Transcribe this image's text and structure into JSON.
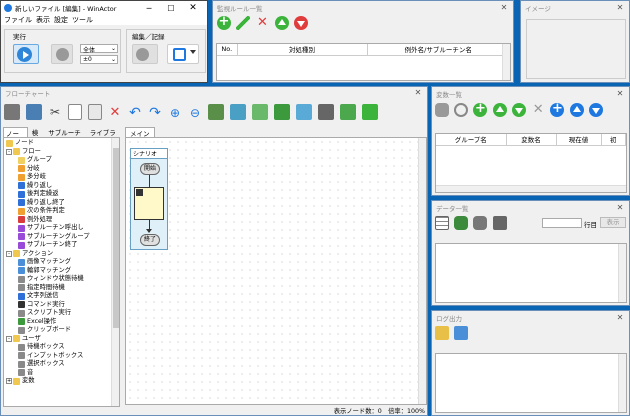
{
  "main_window": {
    "title": "新しいファイル [編集] - WinActor",
    "menu": [
      "ファイル",
      "表示",
      "設定",
      "ツール"
    ],
    "run_group_label": "実行",
    "edit_group_label": "編集／記録",
    "scope_select": "全体",
    "speed_select": "±0"
  },
  "rule_list": {
    "title": "監視ルール一覧",
    "columns": [
      "No.",
      "対処種別",
      "例外名/サブルーチン名"
    ]
  },
  "image_panel": {
    "title": "イメージ"
  },
  "flowchart": {
    "title": "フローチャート",
    "left_tabs": [
      "ノード",
      "検索",
      "サブルーチン",
      "ライブラリ"
    ],
    "canvas_tab": "メイン",
    "scenario_label": "シナリオ",
    "start_label": "開始",
    "end_label": "終了",
    "status": "表示ノード数：0　倍率：100%",
    "tree": [
      {
        "level": 0,
        "label": "ノード",
        "type": "folder",
        "toggle": ""
      },
      {
        "level": 0,
        "label": "フロー",
        "type": "folder",
        "toggle": "-"
      },
      {
        "level": 1,
        "label": "グループ",
        "type": "yellow"
      },
      {
        "level": 1,
        "label": "分岐",
        "type": "orange"
      },
      {
        "level": 1,
        "label": "多分岐",
        "type": "orange"
      },
      {
        "level": 1,
        "label": "繰り返し",
        "type": "blue"
      },
      {
        "level": 1,
        "label": "後判定繰返",
        "type": "blue"
      },
      {
        "level": 1,
        "label": "繰り返し終了",
        "type": "blue"
      },
      {
        "level": 1,
        "label": "次の条件判定",
        "type": "orange"
      },
      {
        "level": 1,
        "label": "例外処理",
        "type": "red"
      },
      {
        "level": 1,
        "label": "サブルーチン呼出し",
        "type": "purple"
      },
      {
        "level": 1,
        "label": "サブルーチングループ",
        "type": "purple"
      },
      {
        "level": 1,
        "label": "サブルーチン終了",
        "type": "purple"
      },
      {
        "level": 0,
        "label": "アクション",
        "type": "folder",
        "toggle": "-"
      },
      {
        "level": 1,
        "label": "画像マッチング",
        "type": "img"
      },
      {
        "level": 1,
        "label": "輪郭マッチング",
        "type": "img"
      },
      {
        "level": 1,
        "label": "ウィンドウ状態待機",
        "type": "gray"
      },
      {
        "level": 1,
        "label": "指定時間待機",
        "type": "gray"
      },
      {
        "level": 1,
        "label": "文字列送信",
        "type": "blue"
      },
      {
        "level": 1,
        "label": "コマンド実行",
        "type": "dark"
      },
      {
        "level": 1,
        "label": "スクリプト実行",
        "type": "gray"
      },
      {
        "level": 1,
        "label": "Excel操作",
        "type": "green"
      },
      {
        "level": 1,
        "label": "クリップボード",
        "type": "gray"
      },
      {
        "level": 0,
        "label": "ユーザ",
        "type": "folder",
        "toggle": "-"
      },
      {
        "level": 1,
        "label": "待機ボックス",
        "type": "gray"
      },
      {
        "level": 1,
        "label": "インプットボックス",
        "type": "gray"
      },
      {
        "level": 1,
        "label": "選択ボックス",
        "type": "gray"
      },
      {
        "level": 1,
        "label": "音",
        "type": "gray"
      },
      {
        "level": 0,
        "label": "変数",
        "type": "folder",
        "toggle": "+"
      }
    ]
  },
  "variable_list": {
    "title": "変数一覧",
    "columns": [
      "グループ名",
      "変数名",
      "現在値",
      "初"
    ]
  },
  "data_list": {
    "title": "データ一覧",
    "row_suffix": "行目",
    "display_button": "表示"
  },
  "log_output": {
    "title": "ログ出力"
  },
  "colors": {
    "desktop": "#0a64b4",
    "green_add": "#3cb43c",
    "red_delete": "#e03c3c",
    "blue_action": "#1e78e0"
  }
}
